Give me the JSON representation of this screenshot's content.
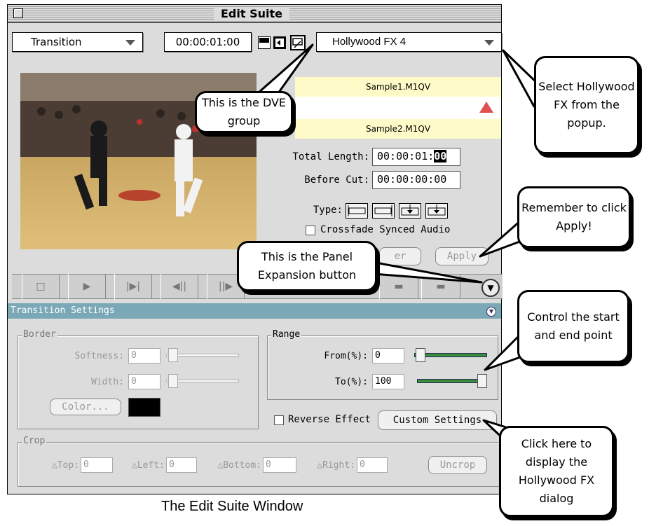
{
  "window": {
    "title": "Edit Suite"
  },
  "toolbar": {
    "transition_label": "Transition",
    "timecode": "00:00:01:00",
    "effect_popup": "Hollywood FX 4"
  },
  "clips": {
    "a": "Sample1.M1QV",
    "b": "Sample2.M1QV"
  },
  "fields": {
    "total_length_label": "Total Length:",
    "total_length_main": "00:00:01:",
    "total_length_frames": "00",
    "before_cut_label": "Before Cut:",
    "before_cut": "00:00:00:00",
    "type_label": "Type:",
    "crossfade_label": "Crossfade Synced Audio",
    "preview_partial": "er",
    "apply_label": "Apply"
  },
  "settings": {
    "header": "Transition Settings",
    "border": {
      "title": "Border",
      "softness_label": "Softness:",
      "softness_value": "0",
      "width_label": "Width:",
      "width_value": "0",
      "color_button": "Color..."
    },
    "range": {
      "title": "Range",
      "from_label": "From(%):",
      "from_value": "0",
      "to_label": "To(%):",
      "to_value": "100"
    },
    "reverse_label": "Reverse Effect",
    "custom_settings": "Custom Settings",
    "crop": {
      "title": "Crop",
      "top_label": "△Top:",
      "top_value": "0",
      "left_label": "△Left:",
      "left_value": "0",
      "bottom_label": "△Bottom:",
      "bottom_value": "0",
      "right_label": "△Right:",
      "right_value": "0",
      "uncrop_label": "Uncrop"
    }
  },
  "callouts": {
    "dve": "This is the DVE group",
    "popup": "Select Hollywood FX from the popup.",
    "apply": "Remember to click Apply!",
    "panel": "This is the Panel Expansion button",
    "range": "Control the start and end point",
    "custom": "Click here to display the Hollywood FX dialog"
  },
  "caption": "The Edit Suite Window",
  "colors": {
    "settings_bar": "#7ba8b7",
    "clip_bar": "#fffbc8",
    "slider_fill": "#3d8a3d",
    "marker": "#e05050"
  }
}
